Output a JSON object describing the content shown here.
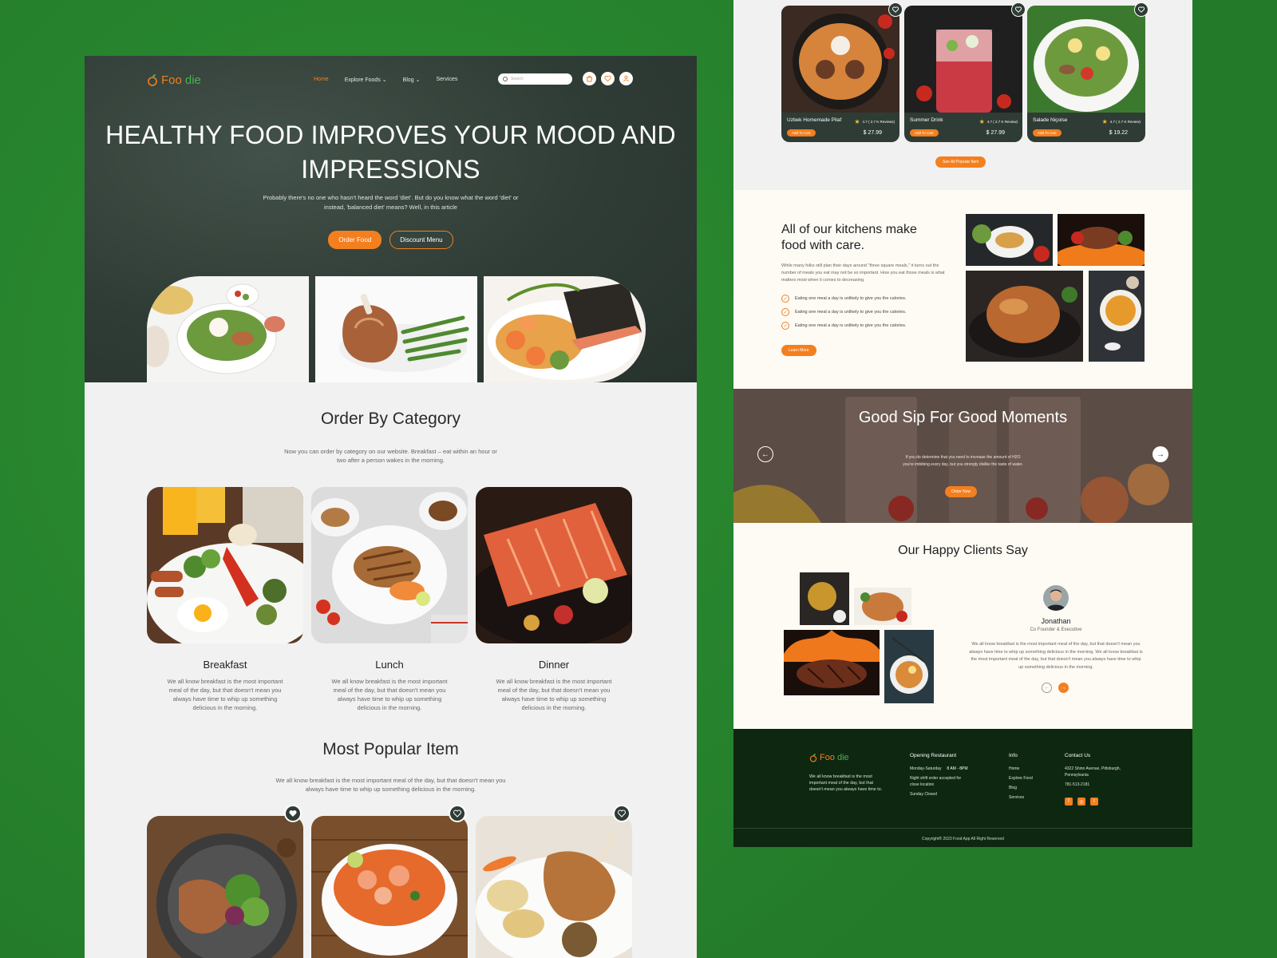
{
  "brand": {
    "name_part1": "Foo",
    "name_part2": "die"
  },
  "nav": {
    "items": [
      "Home",
      "Explore Foods",
      "Blog",
      "Services"
    ],
    "search_placeholder": "Search"
  },
  "hero": {
    "title": "HEALTHY FOOD IMPROVES YOUR MOOD AND IMPRESSIONS",
    "subtitle": "Probably there's no one who hasn't heard the word 'diet'. But do you know what the word 'diet' or instead, 'balanced diet' means? Well, in this article",
    "btn_order": "Order Food",
    "btn_discount": "Discount Menu"
  },
  "category": {
    "title": "Order By Category",
    "subtitle": "Now you can order by category on our website. Breakfast – eat within an hour or two after a person wakes in the morning.",
    "items": [
      {
        "name": "Breakfast",
        "desc": "We all know breakfast is the most important meal of the day, but that doesn't mean you always have time to whip up something delicious in the morning."
      },
      {
        "name": "Lunch",
        "desc": "We all know breakfast is the most important meal of the day, but that doesn't mean you always have time to whip up something delicious in the morning."
      },
      {
        "name": "Dinner",
        "desc": "We all know breakfast is the most important meal of the day, but that doesn't mean you always have time to whip up something delicious in the morning."
      }
    ]
  },
  "popular": {
    "title": "Most Popular Item",
    "subtitle": "We all know breakfast is the most important meal of the day, but that doesn't mean you always have time to whip up something delicious in the morning.",
    "cards": [
      {
        "name": "Uzbek Homemade Pilaf",
        "rating": "4.7 ( 2.7 K Reviews)",
        "add": "Add To Cart",
        "price": "$ 27.99"
      },
      {
        "name": "Summer Drink",
        "rating": "4.7 ( 2.7 K Review)",
        "add": "Add To Cart",
        "price": "$ 27.99"
      },
      {
        "name": "Salade Niçoise",
        "rating": "4.7 ( 2.7 K Review)",
        "add": "Add To Cart",
        "price": "$ 19.22"
      }
    ],
    "see_all": "See All Popular Item"
  },
  "kitchen": {
    "title": "All of our kitchens make food with care.",
    "text": "While many folks still plan their days around \"three square meals,\" it turns out the number of meals you eat may not be so important. How you eat those meals is what matters most when it comes to decreasing.",
    "points": [
      "Eating one meal a day is unlikely to give you the calories.",
      "Eating one meal a day is unlikely to give you the calories.",
      "Eating one meal a day is unlikely to give you the calories."
    ],
    "btn": "Learn More"
  },
  "sip": {
    "title": "Good Sip For Good Moments",
    "text": "If you do determine that you need to increase the amount of H2O you're imbibing every day, but you strongly dislike the taste of water.",
    "btn": "Order Now"
  },
  "clients": {
    "title": "Our Happy Clients Say",
    "name": "Jonathan",
    "role": "Co Founder & Executive",
    "quote": "We all know breakfast is the most important meal of the day, but that doesn't mean you always have time to whip up something delicious in the morning. We all know breakfast is the most important meal of the day, but that doesn't mean you always have time to whip up something delicious in the morning."
  },
  "footer": {
    "desc": "We all know breakfast is the most important meal of the day, but that doesn't mean you always have time to.",
    "opening": {
      "title": "Opening Restaurant",
      "days": "Monday-Saturday",
      "hours": "8 AM - 8PM",
      "night": "Night shift order accepted for close location",
      "sunday": "Sunday Closed"
    },
    "info": {
      "title": "Info",
      "items": [
        "Home",
        "Explore Food",
        "Blog",
        "Services"
      ]
    },
    "contact": {
      "title": "Contact Us",
      "address": "4322 Shinn Avenue, Pittsburgh, Pennsylvania",
      "phone": "781-513-2181"
    },
    "copyright": "Copyright® 2023 Food App All Right Reserved"
  },
  "colors": {
    "accent": "#f47f1f",
    "dark": "#2f3c35",
    "footer": "#0e2710",
    "page_bg": "#27862e"
  }
}
